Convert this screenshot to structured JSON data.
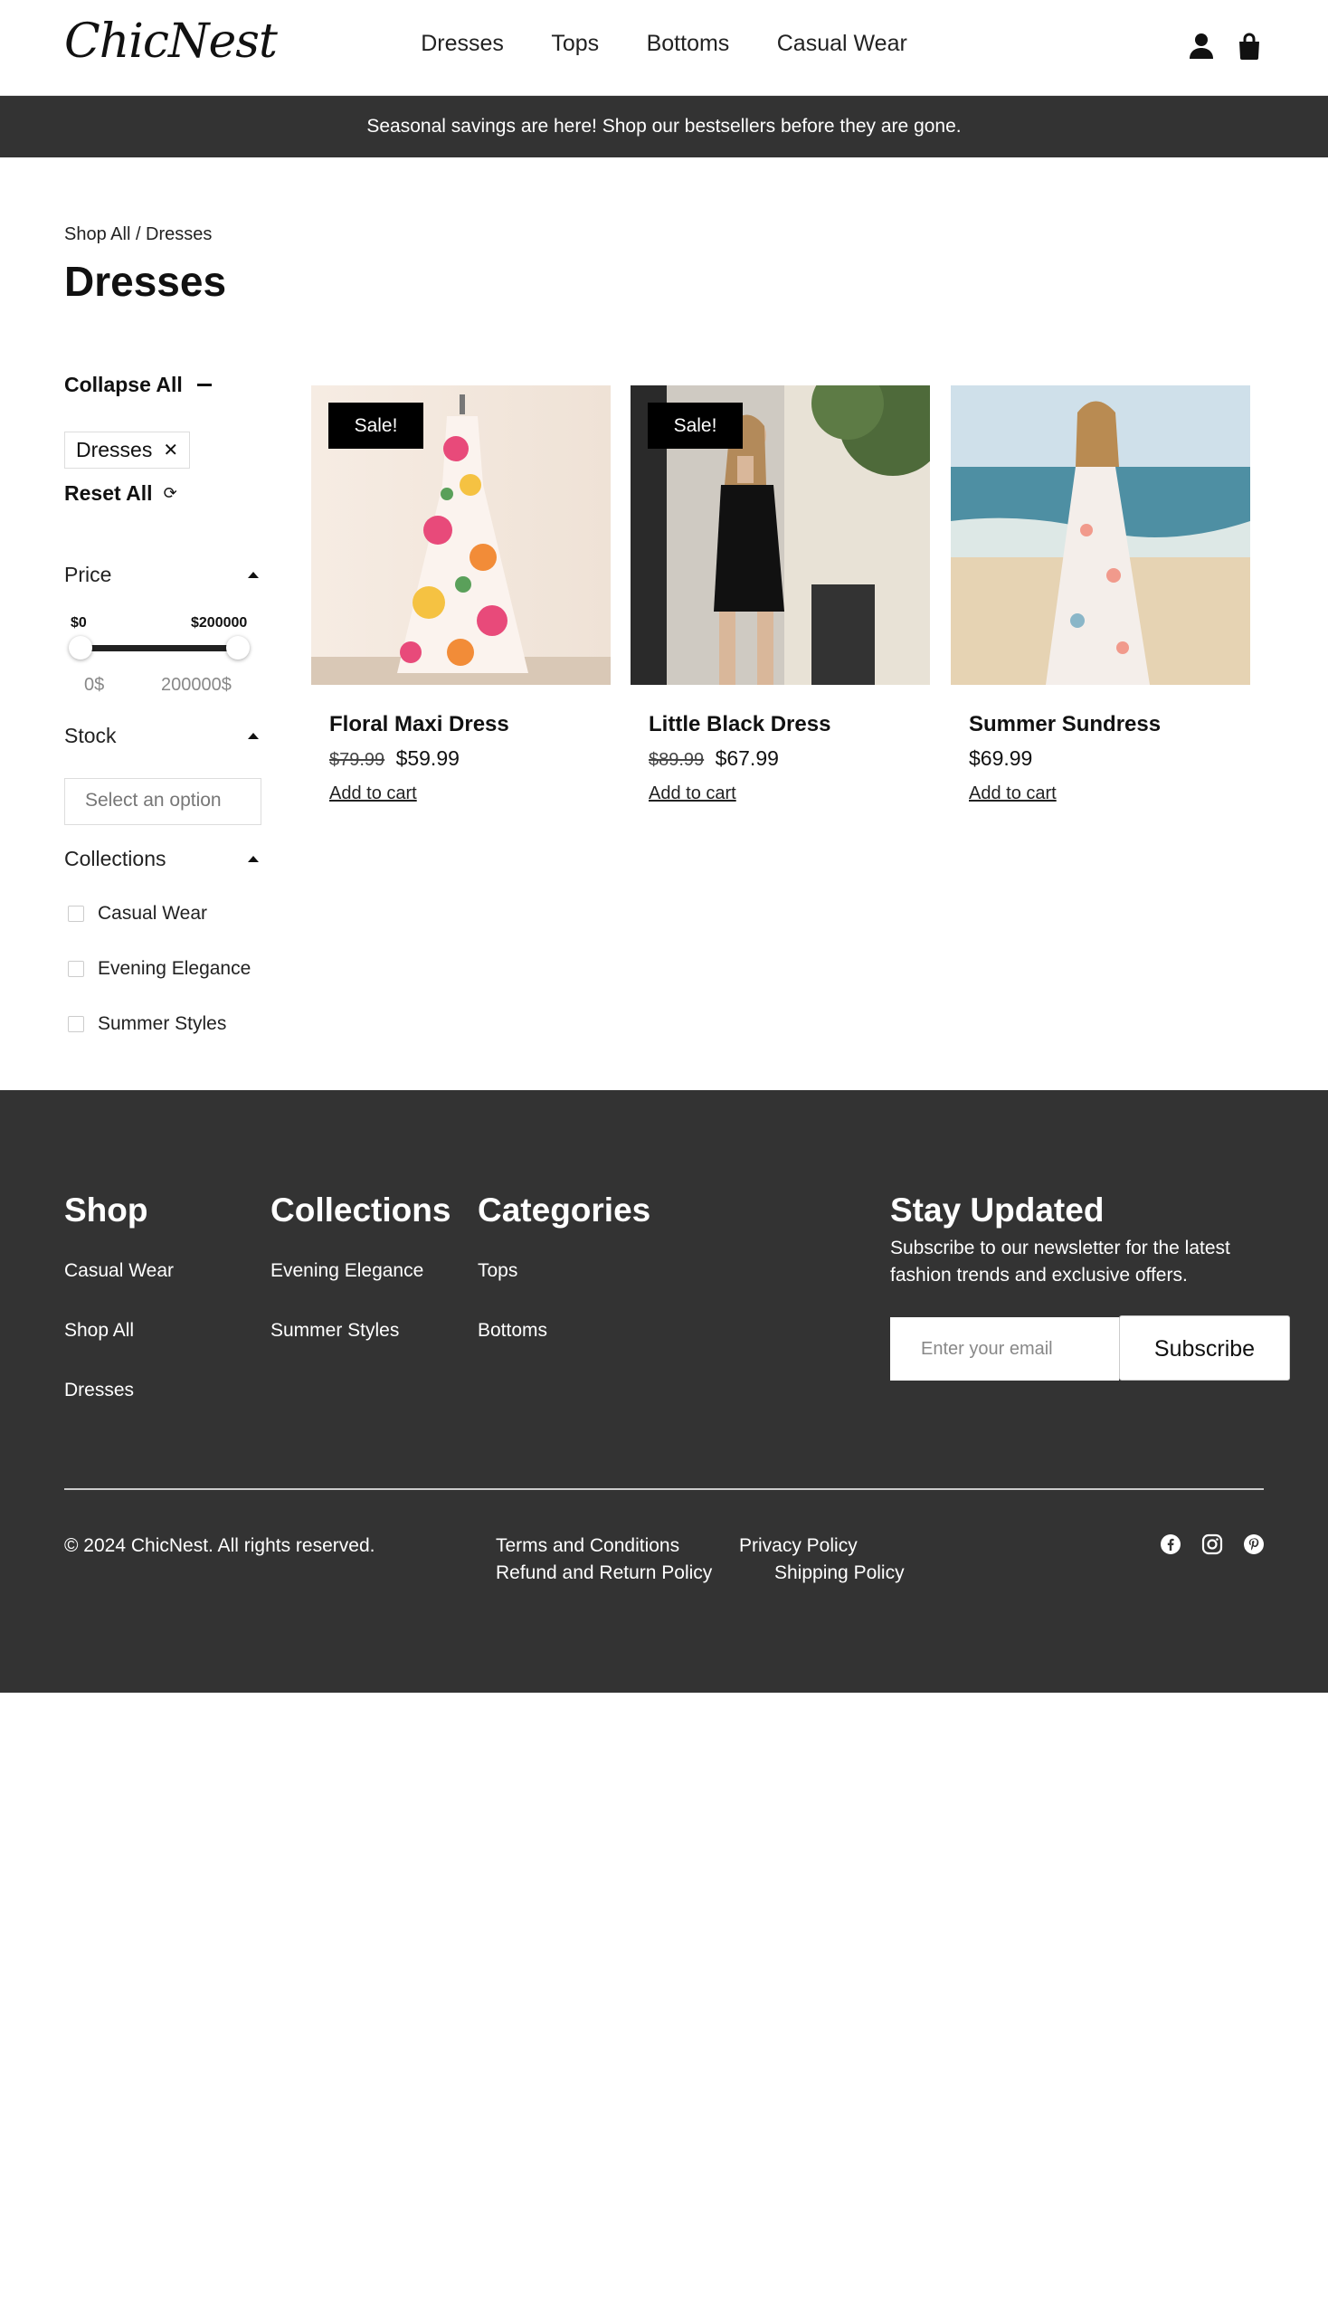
{
  "header": {
    "logo": "ChicNest",
    "nav": [
      "Dresses",
      "Tops",
      "Bottoms",
      "Casual Wear"
    ],
    "icons": [
      "user-icon",
      "shopping-bag-icon"
    ]
  },
  "announcement": "Seasonal savings are here! Shop our bestsellers before they are gone.",
  "breadcrumb": "Shop All / Dresses",
  "page_title": "Dresses",
  "filters": {
    "collapse_all": "Collapse All",
    "active_chip": "Dresses",
    "chip_remove": "✕",
    "reset_all": "Reset All",
    "price": {
      "label": "Price",
      "min_label": "$0",
      "max_label": "$200000",
      "min_value": "0$",
      "max_value": "200000$",
      "range_fraction": [
        0,
        1
      ]
    },
    "stock": {
      "label": "Stock",
      "placeholder": "Select an option"
    },
    "collections": {
      "label": "Collections",
      "options": [
        "Casual Wear",
        "Evening Elegance",
        "Summer Styles"
      ]
    }
  },
  "products": [
    {
      "name": "Floral Maxi Dress",
      "badge": "Sale!",
      "old_price": "$79.99",
      "price": "$59.99",
      "cta": "Add to cart"
    },
    {
      "name": "Little Black Dress",
      "badge": "Sale!",
      "old_price": "$89.99",
      "price": "$67.99",
      "cta": "Add to cart"
    },
    {
      "name": "Summer Sundress",
      "badge": "",
      "old_price": "",
      "price": "$69.99",
      "cta": "Add to cart"
    }
  ],
  "footer": {
    "shop": {
      "title": "Shop",
      "links": [
        "Casual Wear",
        "Shop All",
        "Dresses"
      ]
    },
    "collections": {
      "title": "Collections",
      "links": [
        "Evening Elegance",
        "Summer Styles"
      ]
    },
    "categories": {
      "title": "Categories",
      "links": [
        "Tops",
        "Bottoms"
      ]
    },
    "newsletter": {
      "title": "Stay Updated",
      "text": "Subscribe to our newsletter for the latest fashion trends and exclusive offers.",
      "placeholder": "Enter your email",
      "button": "Subscribe"
    },
    "copyright": "© 2024 ChicNest. All rights reserved.",
    "legal_links": [
      "Terms and Conditions",
      "Privacy Policy",
      "Refund and Return Policy",
      "Shipping Policy"
    ],
    "social_icons": [
      "facebook-icon",
      "instagram-icon",
      "pinterest-icon"
    ]
  },
  "colors": {
    "dark": "#333333",
    "text": "#111111",
    "white": "#ffffff"
  }
}
